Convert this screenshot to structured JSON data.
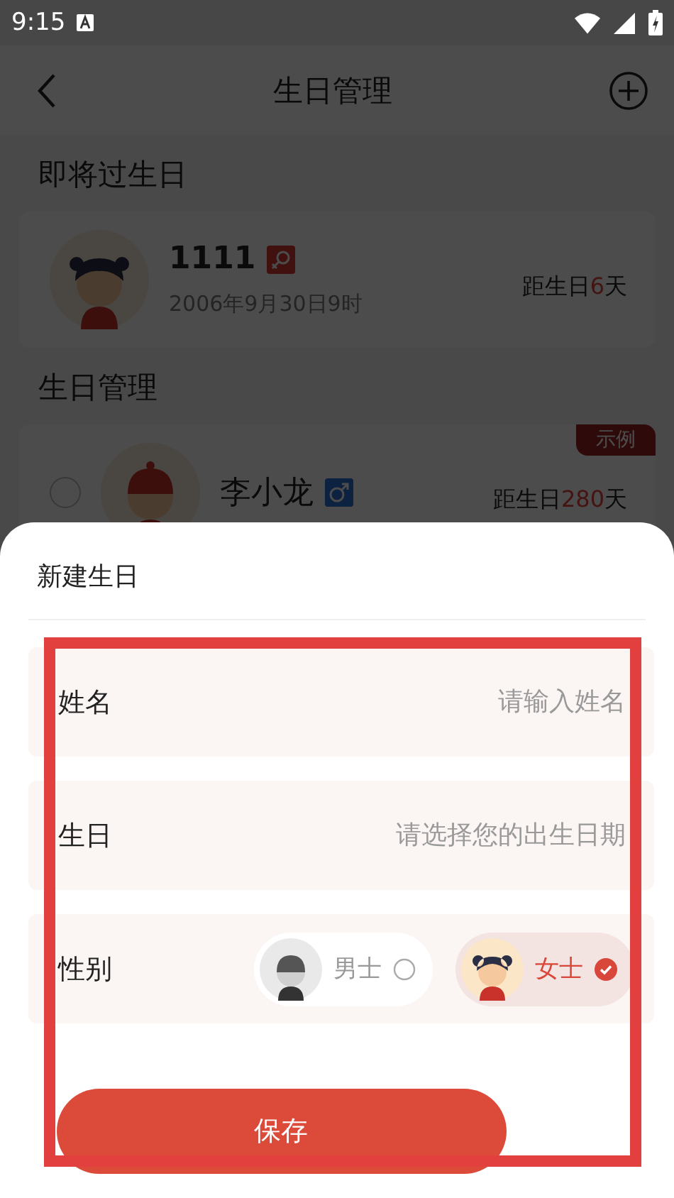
{
  "status_bar": {
    "time": "9:15"
  },
  "header": {
    "title": "生日管理"
  },
  "upcoming": {
    "title": "即将过生日",
    "items": [
      {
        "name": "1111",
        "kind": "female",
        "date": "2006年9月30日9时",
        "countdown_prefix": "距生日",
        "countdown_days": "6",
        "countdown_suffix": "天"
      }
    ]
  },
  "manage": {
    "title": "生日管理",
    "items": [
      {
        "name": "李小龙",
        "kind": "male",
        "tag": "示例",
        "checked": false,
        "countdown_prefix": "距生日",
        "countdown_days": "280",
        "countdown_suffix": "天"
      }
    ]
  },
  "sheet": {
    "title": "新建生日",
    "fields": [
      {
        "kind": "text",
        "label": "姓名",
        "placeholder": "请输入姓名"
      },
      {
        "kind": "date",
        "label": "生日",
        "placeholder": "请选择您的出生日期"
      },
      {
        "kind": "gender",
        "label": "性别",
        "options": [
          {
            "label": "男士",
            "kind": "male",
            "selected": false
          },
          {
            "label": "女士",
            "kind": "female",
            "selected": true
          }
        ]
      }
    ],
    "save_button": "保存"
  }
}
